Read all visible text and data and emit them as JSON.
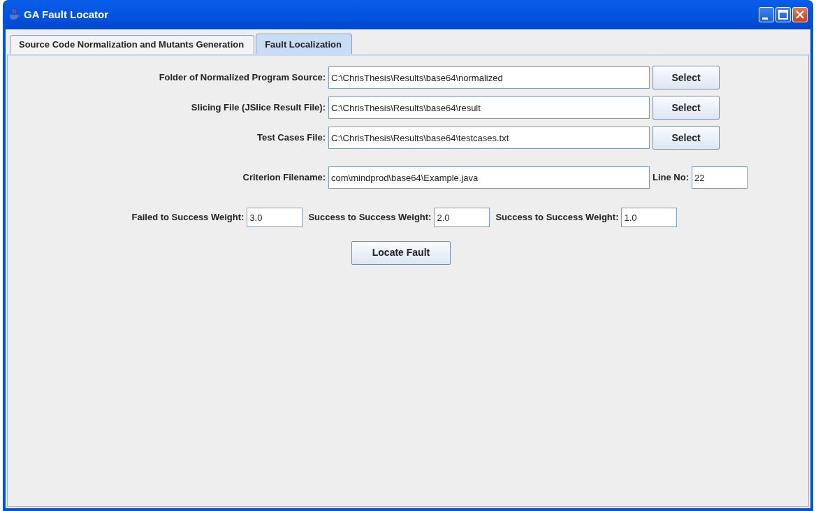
{
  "window": {
    "title": "GA Fault Locator"
  },
  "tabs": [
    {
      "label": "Source Code Normalization and Mutants Generation",
      "selected": false
    },
    {
      "label": "Fault Localization",
      "selected": true
    }
  ],
  "file_rows": [
    {
      "label": "Folder of Normalized Program Source:",
      "value": "C:\\ChrisThesis\\Results\\base64\\normalized",
      "button": "Select"
    },
    {
      "label": "Slicing File (JSlice Result File):",
      "value": "C:\\ChrisThesis\\Results\\base64\\result",
      "button": "Select"
    },
    {
      "label": "Test Cases File:",
      "value": "C:\\ChrisThesis\\Results\\base64\\testcases.txt",
      "button": "Select"
    }
  ],
  "criterion": {
    "label": "Criterion Filename:",
    "value": "com\\mindprod\\base64\\Example.java",
    "line_label": "Line No:",
    "line_value": "22"
  },
  "weights": [
    {
      "label": "Failed to Success Weight:",
      "value": "3.0"
    },
    {
      "label": "Success to Success Weight:",
      "value": "2.0"
    },
    {
      "label": "Success to Success Weight:",
      "value": "1.0"
    }
  ],
  "action_button": "Locate Fault"
}
